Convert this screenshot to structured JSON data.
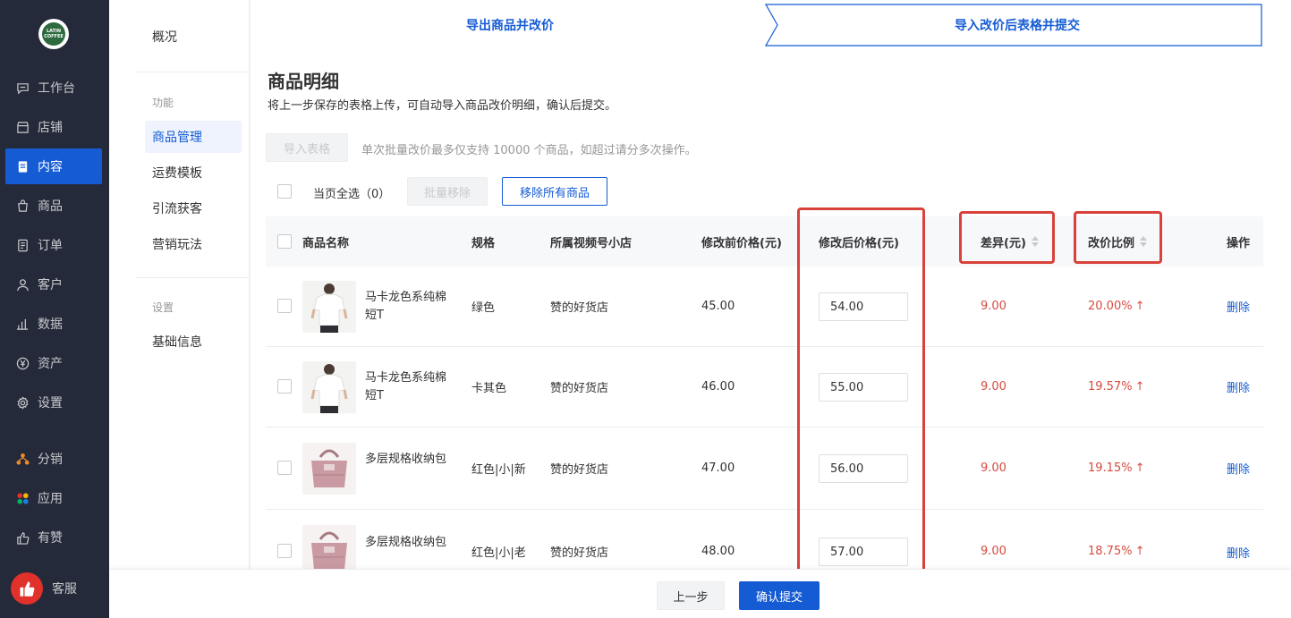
{
  "brand": {
    "logo_text": "LATIN COFFEE"
  },
  "nav": {
    "items": [
      {
        "label": "工作台",
        "icon": "chat-icon"
      },
      {
        "label": "店铺",
        "icon": "store-icon"
      },
      {
        "label": "内容",
        "icon": "document-icon",
        "active": true
      },
      {
        "label": "商品",
        "icon": "bag-icon"
      },
      {
        "label": "订单",
        "icon": "list-icon"
      },
      {
        "label": "客户",
        "icon": "user-icon"
      },
      {
        "label": "数据",
        "icon": "bar-chart-icon"
      },
      {
        "label": "资产",
        "icon": "yen-icon"
      },
      {
        "label": "设置",
        "icon": "gear-icon"
      },
      {
        "label": "分销",
        "icon": "network-icon"
      },
      {
        "label": "应用",
        "icon": "apps-icon"
      },
      {
        "label": "有赞",
        "icon": "thumb-icon"
      }
    ],
    "support_label": "客服",
    "active_color": "#155bd4"
  },
  "subnav": {
    "overview": "概况",
    "section_function": "功能",
    "items": [
      "商品管理",
      "运费模板",
      "引流获客",
      "营销玩法"
    ],
    "section_settings": "设置",
    "settings_items": [
      "基础信息"
    ]
  },
  "steps": {
    "step1": "导出商品并改价",
    "step2": "导入改价后表格并提交"
  },
  "section": {
    "title": "商品明细",
    "desc": "将上一步保存的表格上传，可自动导入商品改价明细，确认后提交。"
  },
  "toolbar": {
    "import_button": "导入表格",
    "import_tip": "单次批量改价最多仅支持 10000 个商品，如超过请分多次操作。",
    "select_all": "当页全选（0）",
    "batch_remove": "批量移除",
    "remove_all": "移除所有商品"
  },
  "table": {
    "headers": {
      "name": "商品名称",
      "spec": "规格",
      "shop": "所属视频号小店",
      "before": "修改前价格(元)",
      "after": "修改后价格(元)",
      "diff": "差异(元)",
      "ratio": "改价比例",
      "action": "操作"
    },
    "rows": [
      {
        "name": "马卡龙色系纯棉短T",
        "spec": "绿色",
        "shop": "赞的好货店",
        "before": "45.00",
        "after": "54.00",
        "diff": "9.00",
        "ratio": "20.00%",
        "action": "删除",
        "thumb": "tshirt"
      },
      {
        "name": "马卡龙色系纯棉短T",
        "spec": "卡其色",
        "shop": "赞的好货店",
        "before": "46.00",
        "after": "55.00",
        "diff": "9.00",
        "ratio": "19.57%",
        "action": "删除",
        "thumb": "tshirt"
      },
      {
        "name": "多层规格收纳包",
        "spec": "红色|小|新",
        "shop": "赞的好货店",
        "before": "47.00",
        "after": "56.00",
        "diff": "9.00",
        "ratio": "19.15%",
        "action": "删除",
        "thumb": "bag"
      },
      {
        "name": "多层规格收纳包",
        "spec": "红色|小|老",
        "shop": "赞的好货店",
        "before": "48.00",
        "after": "57.00",
        "diff": "9.00",
        "ratio": "18.75%",
        "action": "删除",
        "thumb": "bag"
      }
    ],
    "up_arrow": "↑"
  },
  "footer": {
    "prev": "上一步",
    "submit": "确认提交"
  },
  "colors": {
    "accent": "#155bd4",
    "highlight": "#d9423b",
    "increase": "#d64b40"
  }
}
